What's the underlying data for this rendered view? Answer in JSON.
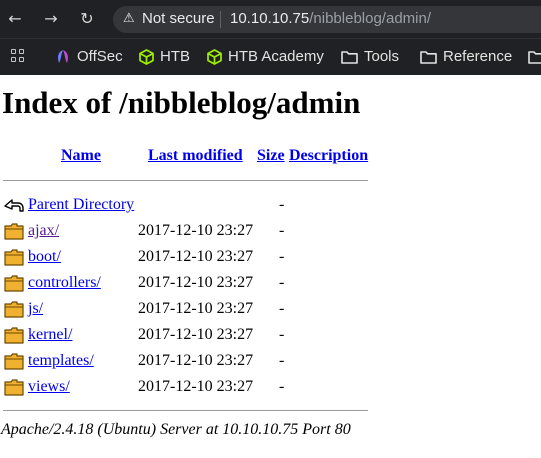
{
  "browser": {
    "security_label": "Not secure",
    "url_host": "10.10.10.75",
    "url_path": "/nibbleblog/admin/",
    "bookmarks": [
      {
        "label": "OffSec",
        "icon": "offsec-icon"
      },
      {
        "label": "HTB",
        "icon": "htb-cube-icon"
      },
      {
        "label": "HTB Academy",
        "icon": "htb-cube-icon"
      },
      {
        "label": "Tools",
        "icon": "folder-icon"
      },
      {
        "label": "Reference",
        "icon": "folder-icon"
      }
    ]
  },
  "colors": {
    "chrome_bg": "#202124",
    "link": "#0000ee",
    "htb_green": "#9fef00",
    "folder_fill": "#f0b030"
  },
  "listing": {
    "title": "Index of /nibbleblog/admin",
    "columns": {
      "name": "Name",
      "last_modified": "Last modified",
      "size": "Size",
      "description": "Description"
    },
    "parent": {
      "name": "Parent Directory",
      "size": "-"
    },
    "entries": [
      {
        "name": "ajax/",
        "modified": "2017-12-10 23:27",
        "size": "-"
      },
      {
        "name": "boot/",
        "modified": "2017-12-10 23:27",
        "size": "-"
      },
      {
        "name": "controllers/",
        "modified": "2017-12-10 23:27",
        "size": "-"
      },
      {
        "name": "js/",
        "modified": "2017-12-10 23:27",
        "size": "-"
      },
      {
        "name": "kernel/",
        "modified": "2017-12-10 23:27",
        "size": "-"
      },
      {
        "name": "templates/",
        "modified": "2017-12-10 23:27",
        "size": "-"
      },
      {
        "name": "views/",
        "modified": "2017-12-10 23:27",
        "size": "-"
      }
    ],
    "footer": "Apache/2.4.18 (Ubuntu) Server at 10.10.10.75 Port 80"
  }
}
